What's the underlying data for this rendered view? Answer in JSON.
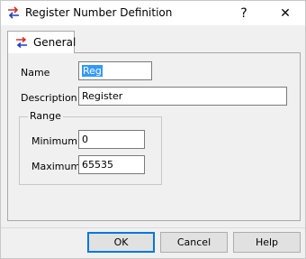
{
  "window": {
    "title": "Register Number Definition",
    "app_icon": "register-swap-icon",
    "help_glyph": "?",
    "close_glyph": "✕"
  },
  "tabs": [
    {
      "label": "General",
      "icon": "register-swap-icon",
      "selected": true
    }
  ],
  "form": {
    "name_label": "Name",
    "name_value": "Reg",
    "description_label": "Description",
    "description_value": "Register",
    "range_title": "Range",
    "minimum_label": "Minimum",
    "minimum_value": "0",
    "maximum_label": "Maximum",
    "maximum_value": "65535"
  },
  "buttons": {
    "ok": "OK",
    "cancel": "Cancel",
    "help": "Help"
  },
  "colors": {
    "selection": "#3399ff",
    "default_button_border": "#0078d7",
    "icon_red": "#d22c2c",
    "icon_blue": "#1e3fbf"
  }
}
